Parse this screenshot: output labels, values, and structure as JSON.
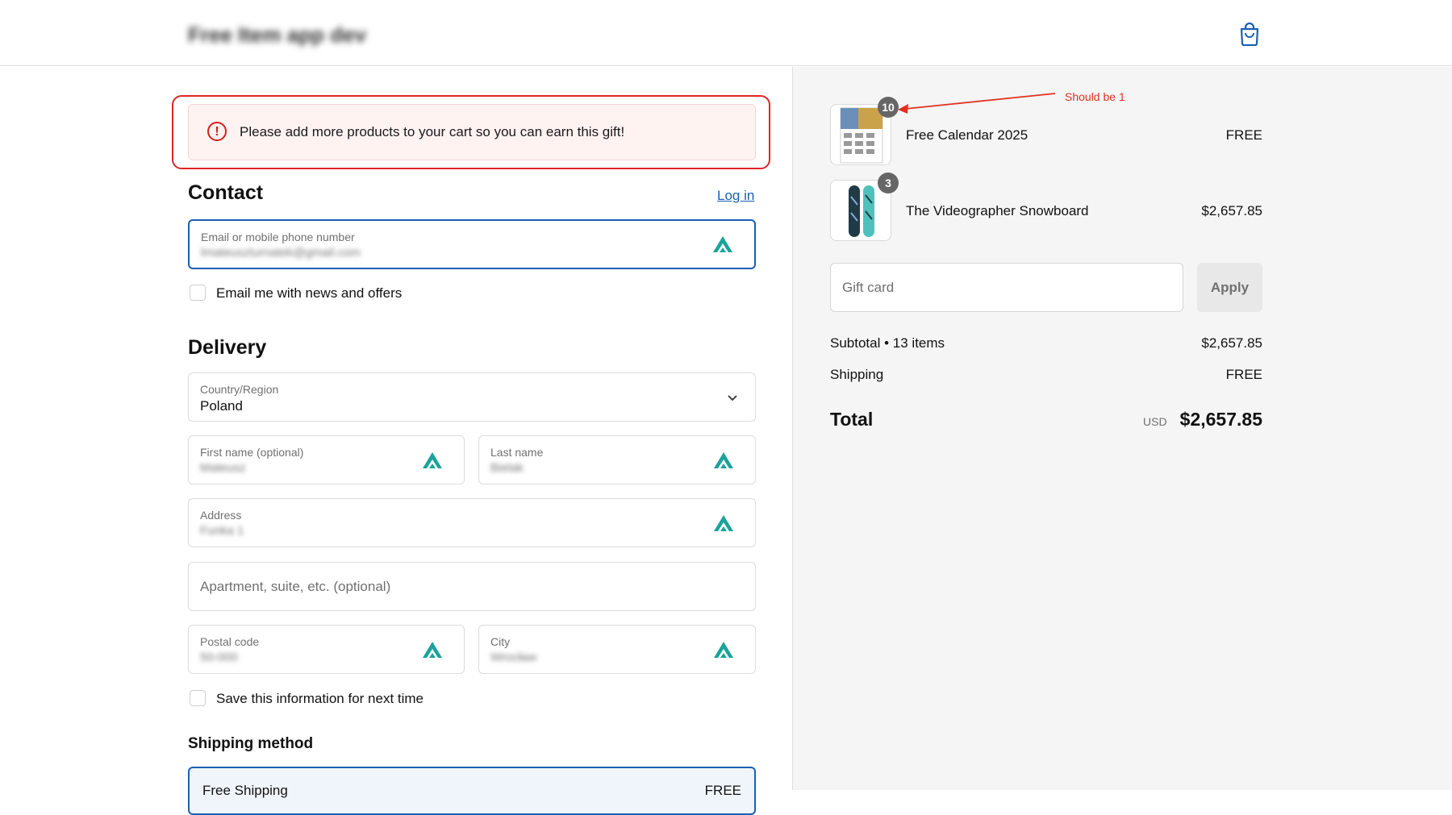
{
  "header": {
    "store_name": "Free Item app dev"
  },
  "alert": {
    "message": "Please add more products to your cart so you can earn this gift!"
  },
  "contact": {
    "title": "Contact",
    "login_link": "Log in",
    "email_label": "Email or mobile phone number",
    "email_value": "lmateuszturnatek@gmail.com",
    "newsletter_label": "Email me with news and offers"
  },
  "delivery": {
    "title": "Delivery",
    "country_label": "Country/Region",
    "country_value": "Poland",
    "first_name_label": "First name (optional)",
    "first_name_value": "Mateusz",
    "last_name_label": "Last name",
    "last_name_value": "Bielak",
    "address_label": "Address",
    "address_value": "Funka 1",
    "apartment_placeholder": "Apartment, suite, etc. (optional)",
    "postal_label": "Postal code",
    "postal_value": "50-000",
    "city_label": "City",
    "city_value": "Wrocław",
    "save_info_label": "Save this information for next time"
  },
  "shipping_method": {
    "title": "Shipping method",
    "option_label": "Free Shipping",
    "option_price": "FREE"
  },
  "order": {
    "items": [
      {
        "name": "Free Calendar 2025",
        "price": "FREE",
        "quantity": "10"
      },
      {
        "name": "The Videographer Snowboard",
        "price": "$2,657.85",
        "quantity": "3"
      }
    ],
    "gift_card_placeholder": "Gift card",
    "apply_label": "Apply",
    "subtotal_label": "Subtotal • 13 items",
    "subtotal_value": "$2,657.85",
    "shipping_label": "Shipping",
    "shipping_value": "FREE",
    "total_label": "Total",
    "currency": "USD",
    "total_value": "$2,657.85"
  },
  "annotation": {
    "text": "Should be 1",
    "color": "#e0301e"
  },
  "colors": {
    "accent": "#1a5fb4",
    "error": "#d61f1f",
    "nord_icon": "#1aa39a"
  }
}
